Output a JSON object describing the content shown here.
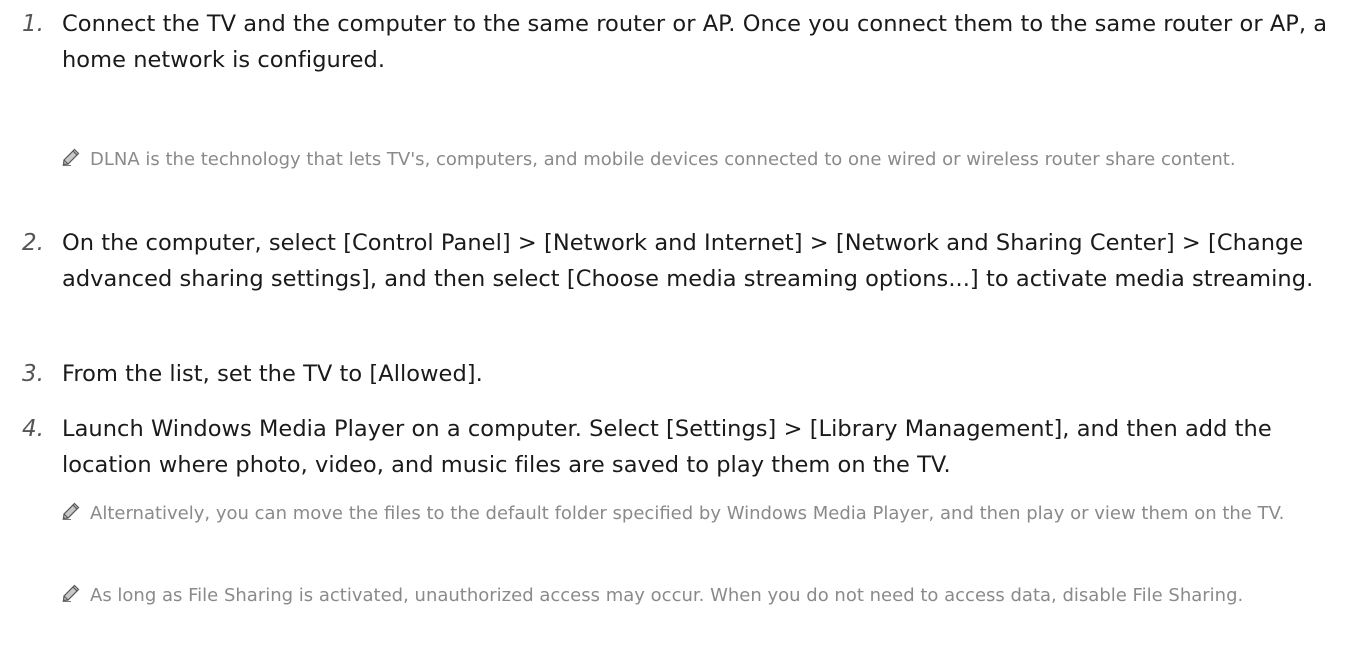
{
  "steps": [
    {
      "number": "1.",
      "text": "Connect the TV and the computer to the same router or AP. Once you connect them to the same router or AP, a home network is configured."
    },
    {
      "number": "2.",
      "text": "On the computer, select [Control Panel] > [Network and Internet] > [Network and Sharing Center] > [Change advanced sharing settings], and then select [Choose media streaming options...] to activate media streaming."
    },
    {
      "number": "3.",
      "text": "From the list, set the TV to [Allowed]."
    },
    {
      "number": "4.",
      "text": "Launch Windows Media Player on a computer. Select [Settings] > [Library Management], and then add the location where photo, video, and music files are saved to play them on the TV."
    }
  ],
  "notes": [
    {
      "icon": "pencil-icon",
      "text": "DLNA is the technology that lets TV's, computers, and mobile devices connected to one wired or wireless router share content."
    },
    {
      "icon": "pencil-icon",
      "text": "Alternatively, you can move the files to the default folder specified by Windows Media Player, and then play or view them on the TV."
    },
    {
      "icon": "pencil-icon",
      "text": "As long as File Sharing is activated, unauthorized access may occur. When you do not need to access data, disable File Sharing."
    }
  ]
}
